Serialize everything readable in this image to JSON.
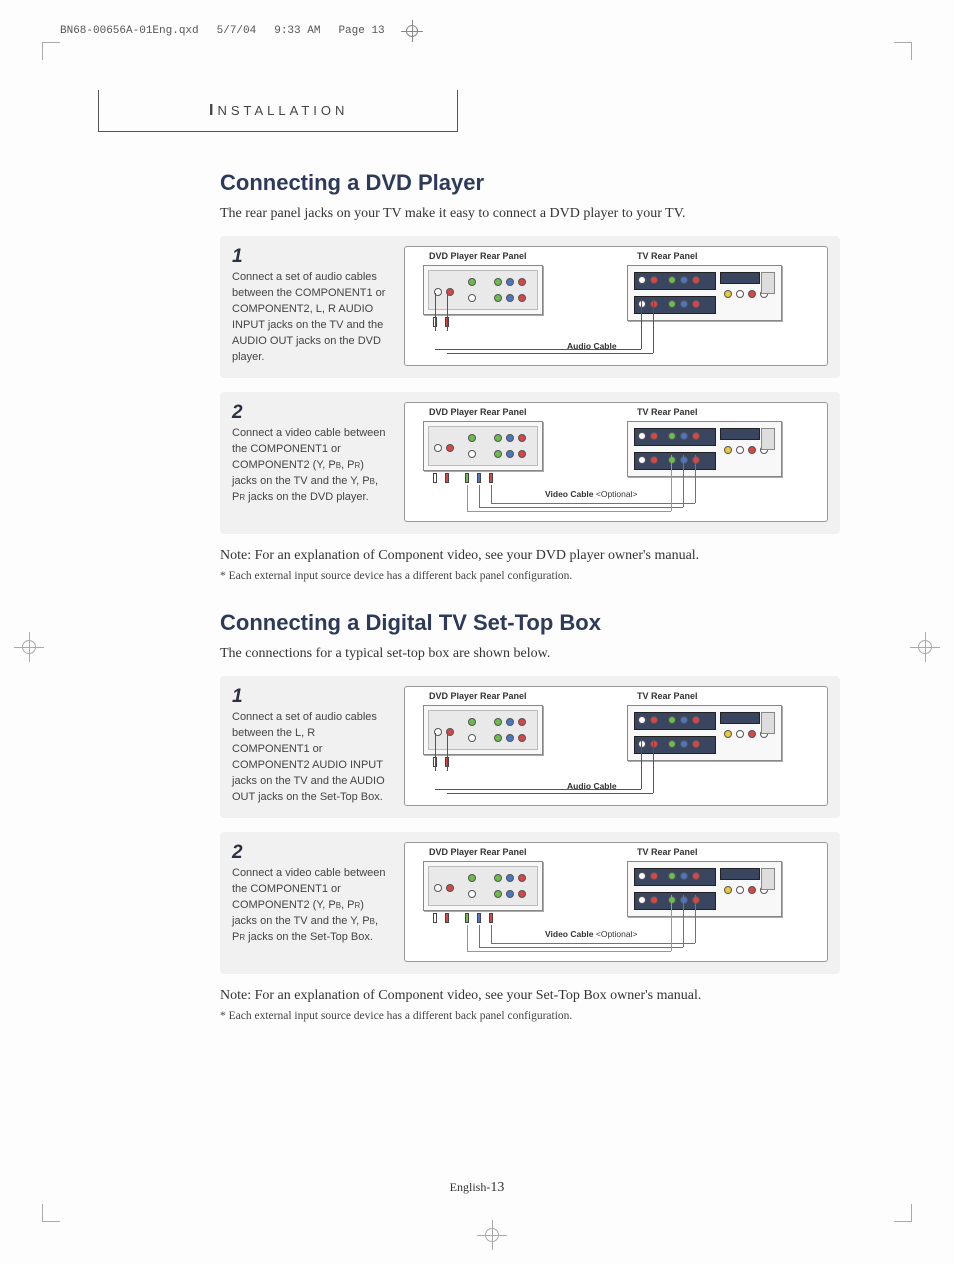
{
  "print_header": {
    "filename": "BN68-00656A-01Eng.qxd",
    "date": "5/7/04",
    "time": "9:33 AM",
    "page_label": "Page 13"
  },
  "section_header": "INSTALLATION",
  "section1": {
    "title": "Connecting a DVD Player",
    "intro": "The rear panel jacks on your TV make it easy to connect a DVD player to your TV.",
    "step1_num": "1",
    "step1_body_a": "Connect a set of audio cables between the COMPONENT1 or COMPONENT2, L, R AUDIO INPUT jacks on the TV and the AUDIO OUT jacks on the DVD player.",
    "step2_num": "2",
    "step2_body_a": "Connect a video cable between the COMPONENT1 or COMPONENT2 (Y, P",
    "step2_body_b": ", P",
    "step2_body_c": ") jacks on the TV and the Y, P",
    "step2_body_d": ", P",
    "step2_body_e": " jacks on the DVD player.",
    "note": "Note: For an explanation of Component video, see your DVD player owner's manual.",
    "asterisk": "*  Each external input source device has a different back panel configuration.",
    "diag": {
      "dvd_label": "DVD Player Rear Panel",
      "tv_label": "TV Rear Panel",
      "audio_cable": "Audio Cable",
      "video_cable": "Video Cable",
      "video_optional": "<Optional>"
    }
  },
  "section2": {
    "title": "Connecting a Digital TV Set-Top Box",
    "intro": "The connections for a typical set-top box are shown below.",
    "step1_num": "1",
    "step1_body_a": "Connect a set of audio cables between the L, R COMPONENT1 or COMPONENT2 AUDIO INPUT jacks on the TV and the AUDIO OUT jacks on the Set-Top Box.",
    "step2_num": "2",
    "step2_body_a": "Connect a video cable between the COMPONENT1 or COMPONENT2 (Y, P",
    "step2_body_b": ", P",
    "step2_body_c": ") jacks on the TV and the Y, P",
    "step2_body_d": ", P",
    "step2_body_e": " jacks on the Set-Top Box.",
    "note": "Note: For an explanation of Component video, see your Set-Top Box owner's manual.",
    "asterisk": "*  Each external input source device has a different back panel configuration."
  },
  "page_footer_prefix": "English-",
  "page_footer_num": "13"
}
